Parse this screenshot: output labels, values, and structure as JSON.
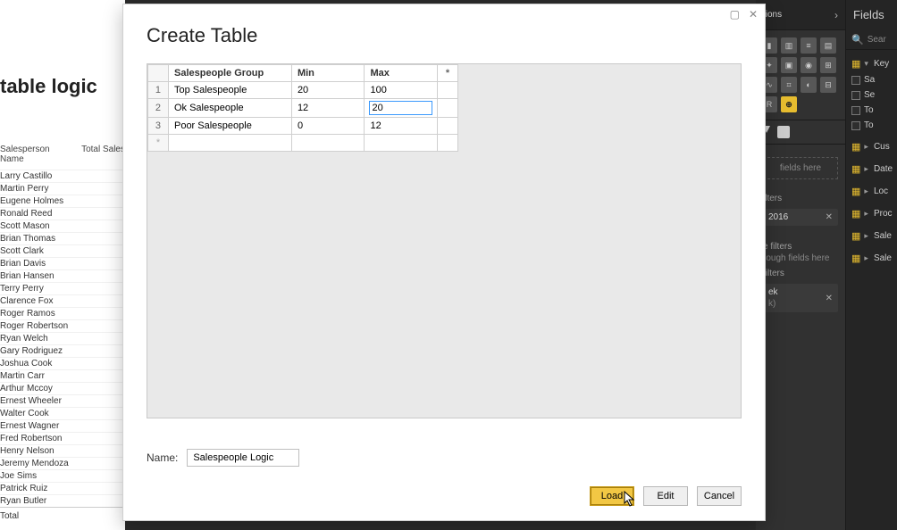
{
  "background": {
    "left_title": "table logic",
    "sal_headers": {
      "name": "Salesperson Name",
      "total": "Total Sales"
    },
    "salespeople": [
      "Larry Castillo",
      "Martin Perry",
      "Eugene Holmes",
      "Ronald Reed",
      "Scott Mason",
      "Brian Thomas",
      "Scott Clark",
      "Brian Davis",
      "Brian Hansen",
      "Terry Perry",
      "Clarence Fox",
      "Roger Ramos",
      "Roger Robertson",
      "Ryan Welch",
      "Gary Rodriguez",
      "Joshua Cook",
      "Martin Carr",
      "Arthur Mccoy",
      "Ernest Wheeler",
      "Walter Cook",
      "Ernest Wagner",
      "Fred Robertson",
      "Henry Nelson",
      "Jeremy Mendoza",
      "Joe Sims",
      "Patrick Ruiz",
      "Ryan Butler"
    ],
    "total_label": "Total"
  },
  "viz": {
    "title": "tions",
    "drop_text": "fields here",
    "filters_title": "ilters",
    "filter_value": "2016",
    "page_filters": "e filters",
    "drill_text": "rough fields here",
    "level_filters": "filters",
    "pill_line1": "ek",
    "pill_line2": "k)"
  },
  "fields": {
    "title": "Fields",
    "search_placeholder": "Sear",
    "top_table": "Key",
    "top_cols": [
      "Sa",
      "Se",
      "To",
      "To"
    ],
    "tables": [
      "Cus",
      "Date",
      "Loc",
      "Proc",
      "Sale",
      "Sale"
    ]
  },
  "modal": {
    "title": "Create Table",
    "columns": {
      "c1": "Salespeople Group",
      "c2": "Min",
      "c3": "Max",
      "star": "*"
    },
    "rows": [
      {
        "n": "1",
        "group": "Top Salespeople",
        "min": "20",
        "max": "100"
      },
      {
        "n": "2",
        "group": "Ok Salespeople",
        "min": "12",
        "max": "20"
      },
      {
        "n": "3",
        "group": "Poor Salespeople",
        "min": "0",
        "max": "12"
      }
    ],
    "newrow_marker": "*",
    "name_label": "Name:",
    "name_value": "Salespeople Logic",
    "buttons": {
      "load": "Load",
      "edit": "Edit",
      "cancel": "Cancel"
    }
  }
}
